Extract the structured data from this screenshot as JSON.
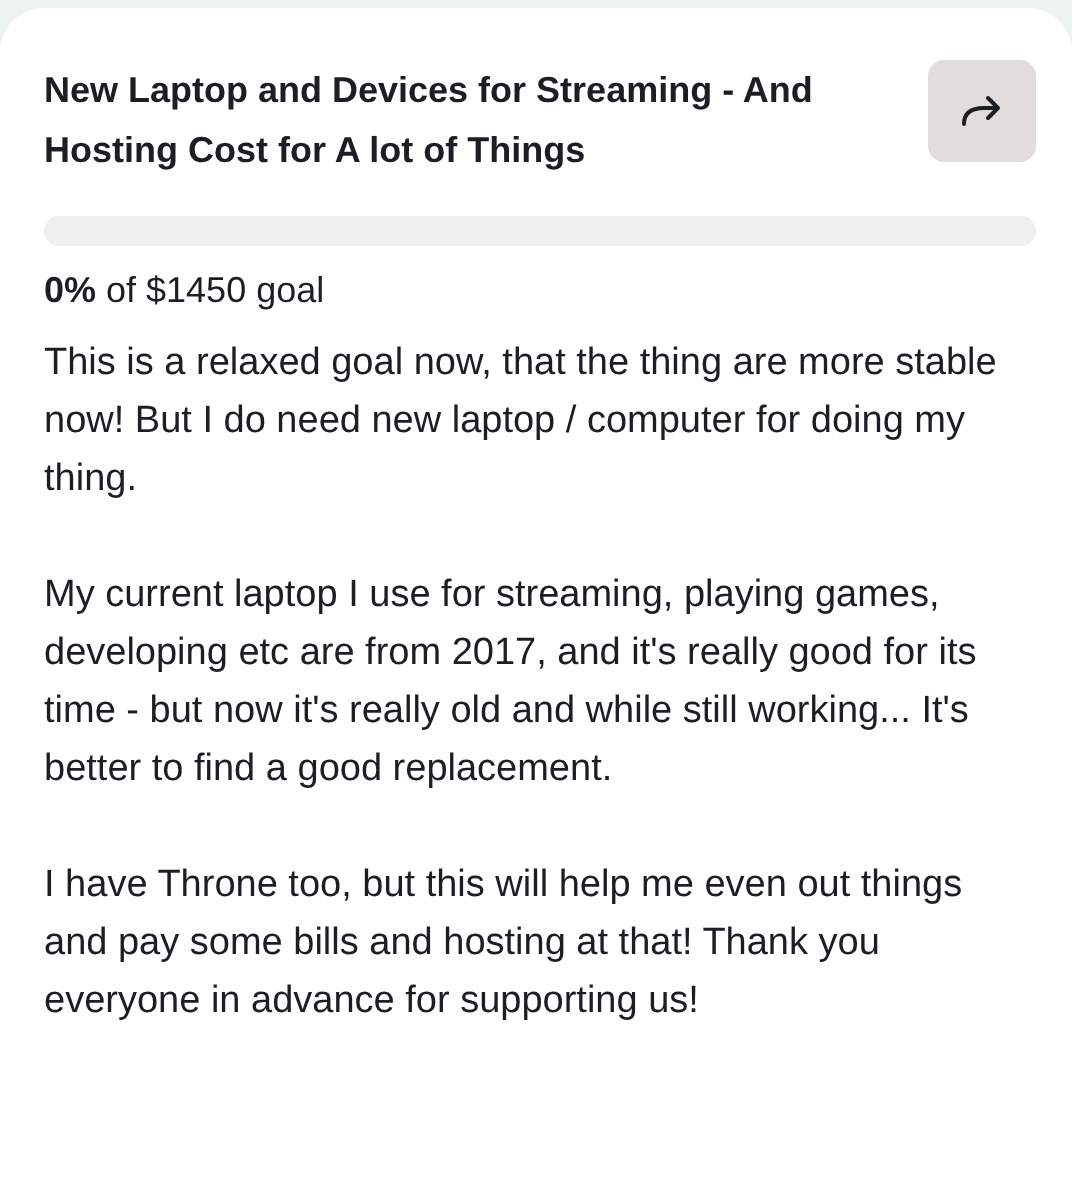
{
  "title": "New Laptop and Devices for Streaming - And Hosting Cost for A lot of Things",
  "progress": {
    "level": 0,
    "summary": "**0%** of $1450 goal"
  },
  "paragraphs": [
    "This is a relaxed goal now, that the thing are more stable now! But I do need new laptop / computer for doing my thing.",
    "My current laptop I use for streaming, playing games, developing etc are from 2017, and it's really good for its time - but now it's really old and while still working... It's better to find a good replacement.",
    "I have Throne too, but this will help me even out things and pay some bills and hosting at that! Thank you everyone in advance for supporting us!"
  ]
}
